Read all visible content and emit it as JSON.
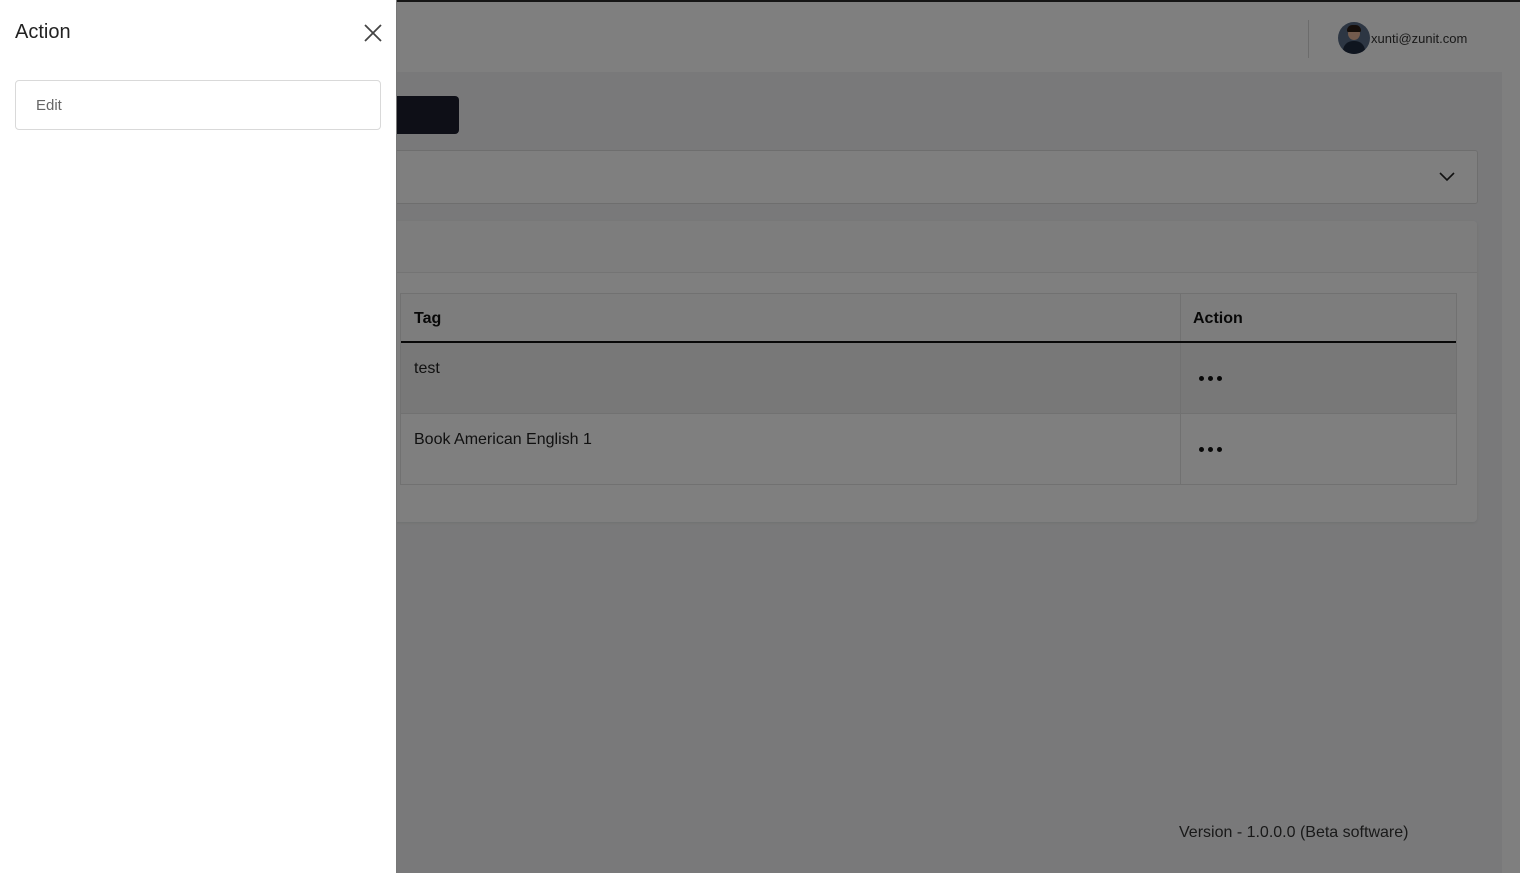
{
  "header": {
    "user_email": "xunti@zunit.com"
  },
  "table": {
    "columns": [
      "Tag",
      "Action"
    ],
    "rows": [
      {
        "tag": "test"
      },
      {
        "tag": "Book American English 1"
      }
    ]
  },
  "footer": {
    "version": "Version - 1.0.0.0 (Beta software)"
  },
  "drawer": {
    "title": "Action",
    "items": [
      {
        "label": "Edit"
      }
    ]
  },
  "icons": {
    "close": "close-icon",
    "more": "more-horizontal-icon",
    "chevron": "chevron-down-icon",
    "avatar": "user-avatar"
  },
  "colors": {
    "overlay": "rgba(0,0,0,0.5)",
    "primary_button": "#1c1f2e"
  }
}
